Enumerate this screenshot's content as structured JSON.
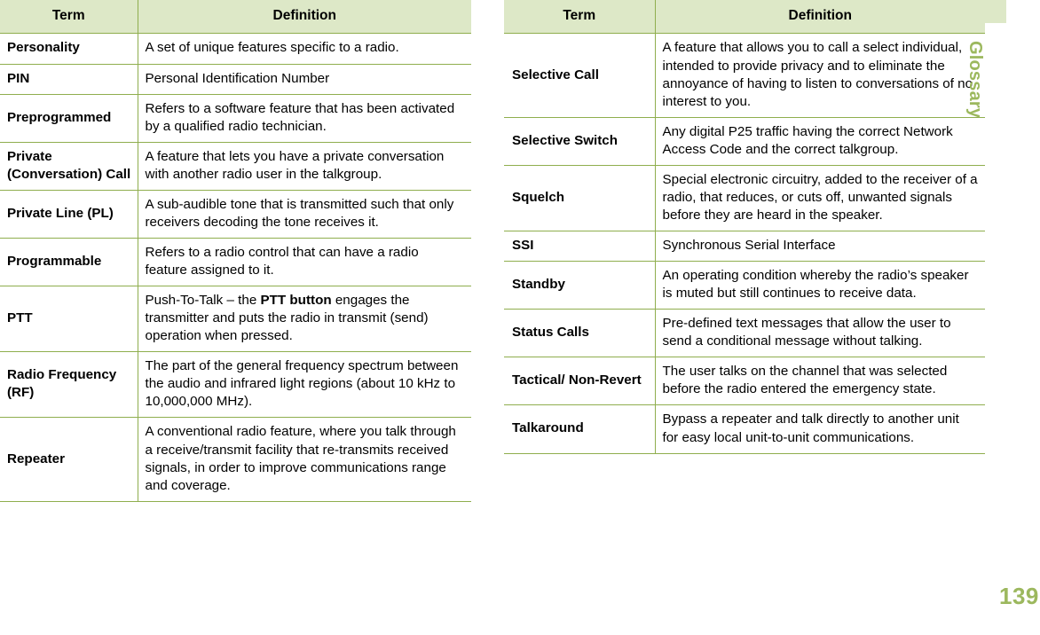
{
  "sidebar": {
    "section_label": "Glossary",
    "page_number": "139",
    "accent_color": "#9cb85e",
    "tab_color": "#dde8c7"
  },
  "theme": {
    "header_background": "#dde8c7",
    "border_color": "#8fae4e",
    "text_color": "#000000"
  },
  "left_table": {
    "headers": {
      "term": "Term",
      "definition": "Definition"
    },
    "rows": [
      {
        "term": "Personality",
        "definition": "A set of unique features specific to a radio."
      },
      {
        "term": "PIN",
        "definition": "Personal Identification Number"
      },
      {
        "term": "Preprogrammed",
        "definition": "Refers to a software feature that has been activated by a qualified radio technician."
      },
      {
        "term": "Private (Conversation) Call",
        "definition": "A feature that lets you have a private conversation with another radio user in the talkgroup."
      },
      {
        "term": "Private Line (PL)",
        "definition": "A sub-audible tone that is transmitted such that only receivers decoding the tone receives it."
      },
      {
        "term": "Programmable",
        "definition": "Refers to a radio control that can have a radio feature assigned to it."
      },
      {
        "term": "PTT",
        "definition_parts": [
          {
            "text": "Push-To-Talk – the ",
            "bold": false
          },
          {
            "text": "PTT button",
            "bold": true
          },
          {
            "text": " engages the transmitter and puts the radio in transmit (send) operation when pressed.",
            "bold": false
          }
        ],
        "definition": "Push-To-Talk – the PTT button engages the transmitter and puts the radio in transmit (send) operation when pressed."
      },
      {
        "term": "Radio Frequency (RF)",
        "definition": "The part of the general frequency spectrum between the audio and infrared light regions (about 10 kHz to 10,000,000 MHz)."
      },
      {
        "term": "Repeater",
        "definition": "A conventional radio feature, where you talk through a receive/transmit facility that re-transmits received signals, in order to improve communications range and coverage."
      }
    ]
  },
  "right_table": {
    "headers": {
      "term": "Term",
      "definition": "Definition"
    },
    "rows": [
      {
        "term": "Selective Call",
        "definition": "A feature that allows you to call a select individual, intended to provide privacy and to eliminate the annoyance of having to listen to conversations of no interest to you."
      },
      {
        "term": "Selective Switch",
        "definition": "Any digital P25 traffic having the correct Network Access Code and the correct talkgroup."
      },
      {
        "term": "Squelch",
        "definition": "Special electronic circuitry, added to the receiver of a radio, that reduces, or cuts off, unwanted signals before they are heard in the speaker."
      },
      {
        "term": "SSI",
        "definition": "Synchronous Serial Interface"
      },
      {
        "term": "Standby",
        "definition": "An operating condition whereby the radio’s speaker is muted but still continues to receive data."
      },
      {
        "term": "Status Calls",
        "definition": "Pre-defined text messages that allow the user to send a conditional message without talking."
      },
      {
        "term": "Tactical/ Non-Revert",
        "definition": "The user talks on the channel that was selected before the radio entered the emergency state."
      },
      {
        "term": "Talkaround",
        "definition": "Bypass a repeater and talk directly to another unit for easy local unit-to-unit communications."
      }
    ]
  }
}
